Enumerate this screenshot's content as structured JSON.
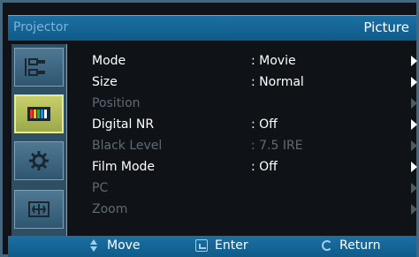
{
  "header": {
    "title_left": "Projector",
    "title_right": "Picture"
  },
  "sidebar": {
    "items": [
      {
        "icon": "input-icon"
      },
      {
        "icon": "picture-bars-icon",
        "active": true
      },
      {
        "icon": "setup-gear-icon"
      },
      {
        "icon": "display-position-icon"
      }
    ]
  },
  "menu": {
    "rows": [
      {
        "label": "Mode",
        "value": ": Movie",
        "enabled": true
      },
      {
        "label": "Size",
        "value": ": Normal",
        "enabled": true
      },
      {
        "label": "Position",
        "value": "",
        "enabled": false
      },
      {
        "label": "Digital NR",
        "value": ": Off",
        "enabled": true
      },
      {
        "label": "Black Level",
        "value": ": 7.5 IRE",
        "enabled": false
      },
      {
        "label": "Film Mode",
        "value": ": Off",
        "enabled": true
      },
      {
        "label": "PC",
        "value": "",
        "enabled": false
      },
      {
        "label": "Zoom",
        "value": "",
        "enabled": false
      }
    ]
  },
  "footer": {
    "move_label": "Move",
    "enter_label": "Enter",
    "return_label": "Return"
  }
}
